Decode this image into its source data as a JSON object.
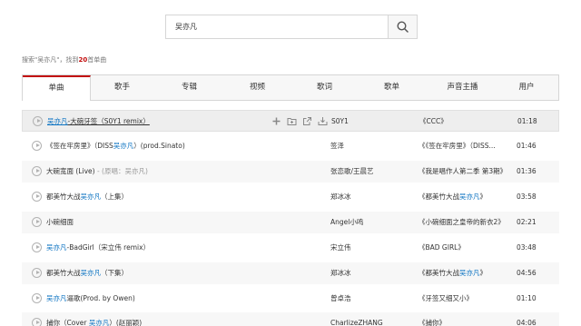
{
  "search": {
    "value": "吴亦凡"
  },
  "result": {
    "prefix": "搜索\"吴亦凡\"，找到",
    "count": "20",
    "suffix": "首单曲"
  },
  "tabs": [
    "单曲",
    "歌手",
    "专辑",
    "视频",
    "歌词",
    "歌单",
    "声音主播",
    "用户"
  ],
  "songs": [
    {
      "hl": "吴亦凡",
      "t": "-大碗牙签（S0Y1 remix）",
      "artist": "S0Y1",
      "album": "《CCC》",
      "dur": "01:18"
    },
    {
      "p1": "《签在牢房里》（DISS",
      "hl": "吴亦凡",
      "t": "）(prod.Sinato)",
      "artist": "签泽",
      "album": "《《签在牢房里》（DISS...",
      "dur": "01:46"
    },
    {
      "p1": "大碗宽面 (Live)",
      "gray": " - (原唱：吴亦凡)",
      "artist": "张恋歌/王晨艺",
      "album": "《我是唱作人第二季 第3期》",
      "dur": "01:36"
    },
    {
      "p1": "都美竹大战",
      "hl": "吴亦凡",
      "t": "（上集）",
      "artist": "郑冰冰",
      "album_pre": "《都美竹大战",
      "album_hl": "吴亦凡",
      "album_post": "》",
      "dur": "03:58"
    },
    {
      "p1": "小碗细面",
      "artist": "Angel小鸣",
      "album": "《小碗细面之皇帝的新衣2》",
      "dur": "02:21"
    },
    {
      "hl": "吴亦凡",
      "t": "-BadGirl（宋立伟 remix）",
      "artist": "宋立伟",
      "album": "《BAD GIRL》",
      "dur": "03:48"
    },
    {
      "p1": "都美竹大战",
      "hl": "吴亦凡",
      "t": "（下集）",
      "artist": "郑冰冰",
      "album_pre": "《都美竹大战",
      "album_hl": "吴亦凡",
      "album_post": "》",
      "dur": "04:56"
    },
    {
      "hl": "吴亦凡",
      "t": "逼歌(Prod. by Owen)",
      "artist": "曾卓浩",
      "album": "《牙签又细又小》",
      "dur": "01:10"
    },
    {
      "p1": "捕你（Cover ",
      "hl": "吴亦凡",
      "t": "）(赵丽颖)",
      "artist": "CharlizeZHANG",
      "album": "《捕你》",
      "dur": "04:06"
    }
  ],
  "icons": {
    "search": "search-icon",
    "play": "play-icon",
    "add": "add-icon",
    "collect": "collect-icon",
    "share": "share-icon",
    "download": "download-icon"
  },
  "colors": {
    "accent": "#c20c0c",
    "link": "#0c73c2"
  }
}
